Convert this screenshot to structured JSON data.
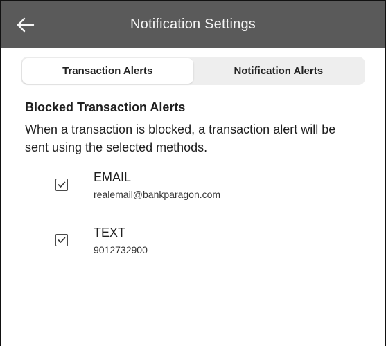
{
  "header": {
    "title": "Notification Settings",
    "back_icon": "arrow-left-icon",
    "background": "#5a5a5a"
  },
  "tabs": [
    {
      "label": "Transaction Alerts",
      "active": true
    },
    {
      "label": "Notification Alerts",
      "active": false
    }
  ],
  "section": {
    "title": "Blocked Transaction Alerts",
    "description": "When a transaction is blocked, a transaction alert will be sent using the selected methods."
  },
  "methods": [
    {
      "label": "EMAIL",
      "value": "realemail@bankparagon.com",
      "checked": true
    },
    {
      "label": "TEXT",
      "value": "9012732900",
      "checked": true
    }
  ]
}
